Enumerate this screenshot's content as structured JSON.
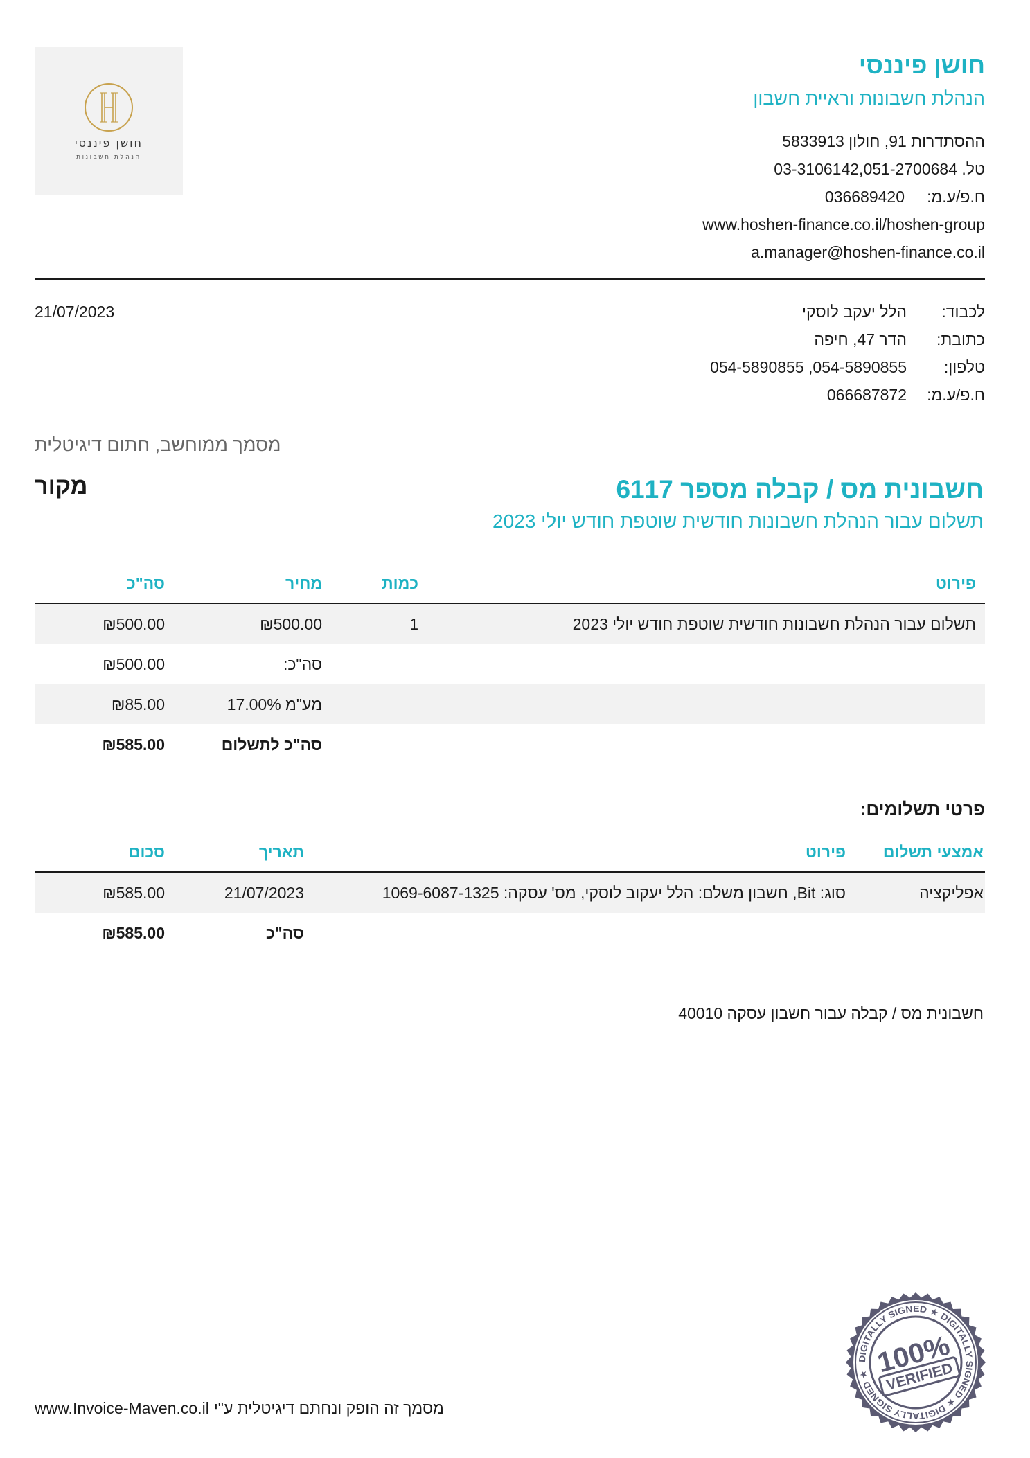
{
  "colors": {
    "accent": "#1eb2c3",
    "text": "#1a1a1a",
    "muted": "#666666",
    "row_shade": "#f2f2f2",
    "logo_bg": "#f2f2f2",
    "logo_gold": "#c8a24e",
    "seal": "#5b5a72",
    "rule": "#1a1a1a"
  },
  "logo": {
    "name": "חושן פיננסי",
    "tagline": "הנהלת חשבונות"
  },
  "company": {
    "name": "חושן פיננסי",
    "subtitle": "הנהלת חשבונות וראיית חשבון",
    "address": "ההסתדרות 91, חולון 5833913",
    "phone": "טל. 03-3106142,051-2700684",
    "tax_id_label": "ח.פ/ע.מ:",
    "tax_id": "036689420",
    "website": "www.hoshen-finance.co.il/hoshen-group",
    "email": "a.manager@hoshen-finance.co.il"
  },
  "customer": {
    "rows": [
      {
        "label": "לכבוד:",
        "value": "הלל יעקב לוסקי"
      },
      {
        "label": "כתובת:",
        "value": "הדר 47, חיפה"
      },
      {
        "label": "טלפון:",
        "value": "054-5890855, 054-5890855"
      },
      {
        "label": "ח.פ/ע.מ:",
        "value": "066687872"
      }
    ]
  },
  "document": {
    "date": "21/07/2023",
    "computerized_note": "מסמך ממוחשב, חתום דיגיטלית",
    "title": "חשבונית מס / קבלה מספר 6117",
    "copy_type": "מקור",
    "subtitle": "תשלום עבור הנהלת חשבונות חודשית שוטפת חודש יולי 2023",
    "footnote": "חשבונית מס / קבלה עבור חשבון עסקה 40010"
  },
  "items_table": {
    "headers": {
      "description": "פירוט",
      "quantity": "כמות",
      "price": "מחיר",
      "total": "סה\"כ"
    },
    "rows": [
      {
        "description": "תשלום עבור הנהלת חשבונות חודשית שוטפת חודש יולי 2023",
        "quantity": "1",
        "price": "₪500.00",
        "total": "₪500.00"
      }
    ],
    "summary": [
      {
        "label": "סה\"כ:",
        "value": "₪500.00"
      },
      {
        "label": "מע\"מ 17.00%",
        "value": "₪85.00"
      },
      {
        "label": "סה\"כ לתשלום",
        "value": "₪585.00"
      }
    ]
  },
  "payments": {
    "title": "פרטי תשלומים:",
    "headers": {
      "method": "אמצעי תשלום",
      "details": "פירוט",
      "date": "תאריך",
      "amount": "סכום"
    },
    "rows": [
      {
        "method": "אפליקציה",
        "details": "סוג: Bit, חשבון משלם: הלל יעקוב לוסקי, מס' עסקה: 1069-6087-1325",
        "date": "21/07/2023",
        "amount": "₪585.00"
      }
    ],
    "total": {
      "label": "סה\"כ",
      "value": "₪585.00"
    }
  },
  "seal": {
    "ring_text": "DIGITALLY SIGNED ★ DIGITALLY SIGNED ★ DIGITALLY SIGNED ★",
    "percent": "100%",
    "label": "VERIFIED"
  },
  "footer": {
    "text": "מסמך זה הופק ונחתם דיגיטלית ע\"י",
    "url": "www.Invoice-Maven.co.il"
  }
}
